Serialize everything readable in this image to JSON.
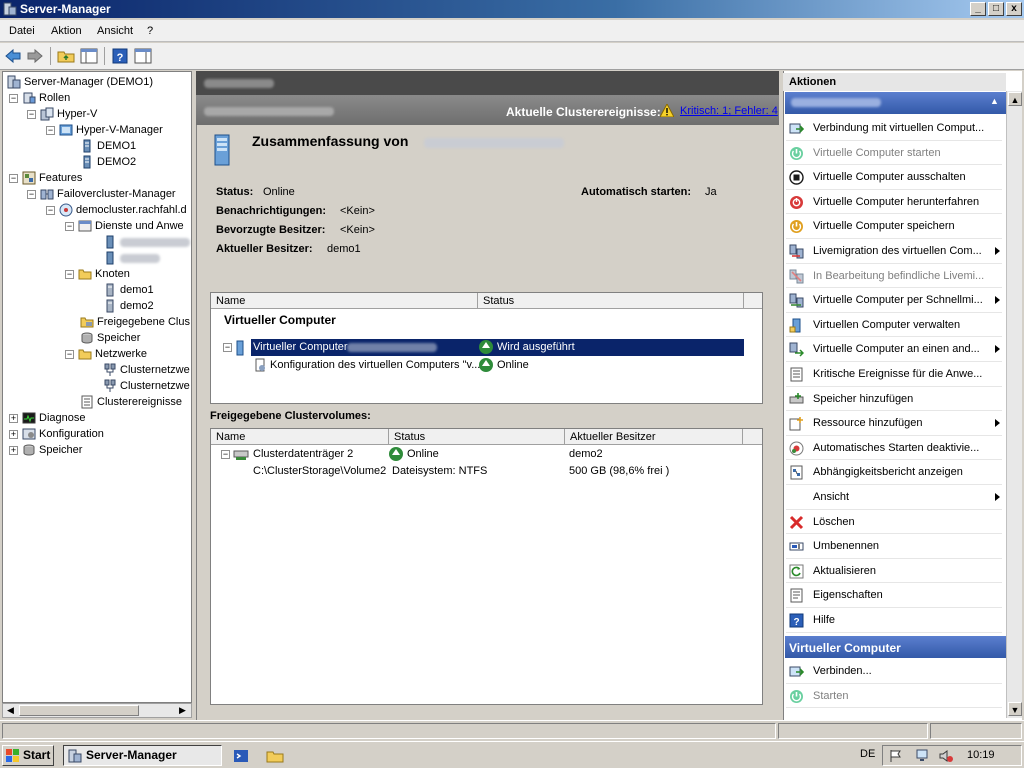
{
  "window": {
    "title": "Server-Manager",
    "controls": {
      "minimize": "_",
      "maximize": "□",
      "close": "x"
    }
  },
  "menu": [
    "Datei",
    "Aktion",
    "Ansicht",
    "?"
  ],
  "tree": {
    "items": [
      {
        "label": "Server-Manager (DEMO1)",
        "icon": "server-manager-icon"
      },
      {
        "label": "Rollen",
        "icon": "roles-icon"
      },
      {
        "label": "Hyper-V",
        "icon": "hyperv-icon"
      },
      {
        "label": "Hyper-V-Manager",
        "icon": "hyperv-manager-icon"
      },
      {
        "label": "DEMO1",
        "icon": "server-icon"
      },
      {
        "label": "DEMO2",
        "icon": "server-icon"
      },
      {
        "label": "Features",
        "icon": "features-icon"
      },
      {
        "label": "Failovercluster-Manager",
        "icon": "failover-cluster-icon"
      },
      {
        "label": "democluster.rachfahl.d",
        "icon": "cluster-icon"
      },
      {
        "label": "Dienste und Anwe",
        "icon": "services-icon"
      },
      {
        "label": "Knoten",
        "icon": "folder-icon"
      },
      {
        "label": "demo1",
        "icon": "server-icon"
      },
      {
        "label": "demo2",
        "icon": "server-icon"
      },
      {
        "label": "Freigegebene Clus",
        "icon": "shared-volume-icon"
      },
      {
        "label": "Speicher",
        "icon": "storage-icon"
      },
      {
        "label": "Netzwerke",
        "icon": "folder-icon"
      },
      {
        "label": "Clusternetzwe",
        "icon": "network-icon"
      },
      {
        "label": "Clusternetzwe",
        "icon": "network-icon"
      },
      {
        "label": "Clusterereignisse",
        "icon": "events-icon"
      },
      {
        "label": "Diagnose",
        "icon": "diagnose-icon"
      },
      {
        "label": "Konfiguration",
        "icon": "config-icon"
      },
      {
        "label": "Speicher",
        "icon": "storage-icon"
      }
    ]
  },
  "center": {
    "events_label": "Aktuelle Clusterereignisse:",
    "events_link": "Kritisch: 1; Fehler: 4",
    "summary_title": "Zusammenfassung von",
    "status_key": "Status:",
    "status_val": "Online",
    "autostart_key": "Automatisch starten:",
    "autostart_val": "Ja",
    "notif_key": "Benachrichtigungen:",
    "notif_val": "<Kein>",
    "preferred_key": "Bevorzugte Besitzer:",
    "preferred_val": "<Kein>",
    "owner_key": "Aktueller Besitzer:",
    "owner_val": "demo1",
    "vm_table": {
      "col_name": "Name",
      "col_status": "Status",
      "group": "Virtueller Computer",
      "rows": [
        {
          "name": "Virtueller Computer",
          "status": "Wird ausgeführt"
        },
        {
          "name": "Konfiguration des virtuellen Computers \"v...",
          "status": "Online"
        }
      ]
    },
    "volumes_title": "Freigegebene Clustervolumes:",
    "vol_table": {
      "col_name": "Name",
      "col_status": "Status",
      "col_owner": "Aktueller Besitzer",
      "rows": [
        {
          "name": "Clusterdatenträger 2",
          "status": "Online",
          "owner": "demo2"
        },
        {
          "name": "C:\\ClusterStorage\\Volume2",
          "status": "Dateisystem: NTFS",
          "owner": "500 GB (98,6% frei )"
        }
      ]
    }
  },
  "actions": {
    "header": "Aktionen",
    "group2_title": "Virtueller Computer",
    "items": [
      {
        "label": "Verbindung mit virtuellen Comput...",
        "icon": "connect-icon",
        "enabled": true,
        "submenu": false
      },
      {
        "label": "Virtuelle Computer starten",
        "icon": "start-icon",
        "enabled": false,
        "submenu": false
      },
      {
        "label": "Virtuelle Computer ausschalten",
        "icon": "power-off-icon",
        "enabled": true,
        "submenu": false
      },
      {
        "label": "Virtuelle Computer herunterfahren",
        "icon": "shutdown-icon",
        "enabled": true,
        "submenu": false
      },
      {
        "label": "Virtuelle Computer speichern",
        "icon": "save-state-icon",
        "enabled": true,
        "submenu": false
      },
      {
        "label": "Livemigration des virtuellen Com...",
        "icon": "live-migration-icon",
        "enabled": true,
        "submenu": true
      },
      {
        "label": "In Bearbeitung befindliche Livemi...",
        "icon": "migration-progress-icon",
        "enabled": false,
        "submenu": false
      },
      {
        "label": "Virtuelle Computer per Schnellmi...",
        "icon": "quick-migration-icon",
        "enabled": true,
        "submenu": true
      },
      {
        "label": "Virtuellen Computer verwalten",
        "icon": "manage-vm-icon",
        "enabled": true,
        "submenu": false
      },
      {
        "label": "Virtuelle Computer an einen and...",
        "icon": "move-vm-icon",
        "enabled": true,
        "submenu": true
      },
      {
        "label": "Kritische Ereignisse für die Anwe...",
        "icon": "critical-events-icon",
        "enabled": true,
        "submenu": false
      },
      {
        "label": "Speicher hinzufügen",
        "icon": "add-storage-icon",
        "enabled": true,
        "submenu": false
      },
      {
        "label": "Ressource hinzufügen",
        "icon": "add-resource-icon",
        "enabled": true,
        "submenu": true
      },
      {
        "label": "Automatisches Starten deaktivie...",
        "icon": "autostart-icon",
        "enabled": true,
        "submenu": false
      },
      {
        "label": "Abhängigkeitsbericht anzeigen",
        "icon": "report-icon",
        "enabled": true,
        "submenu": false
      },
      {
        "label": "Ansicht",
        "icon": "",
        "enabled": true,
        "submenu": true
      },
      {
        "label": "Löschen",
        "icon": "delete-icon",
        "enabled": true,
        "submenu": false
      },
      {
        "label": "Umbenennen",
        "icon": "rename-icon",
        "enabled": true,
        "submenu": false
      },
      {
        "label": "Aktualisieren",
        "icon": "refresh-icon",
        "enabled": true,
        "submenu": false
      },
      {
        "label": "Eigenschaften",
        "icon": "properties-icon",
        "enabled": true,
        "submenu": false
      },
      {
        "label": "Hilfe",
        "icon": "help-icon",
        "enabled": true,
        "submenu": false
      }
    ],
    "group2_items": [
      {
        "label": "Verbinden...",
        "icon": "connect-icon",
        "enabled": true
      },
      {
        "label": "Starten",
        "icon": "start-icon",
        "enabled": false
      }
    ]
  },
  "taskbar": {
    "start_label": "Start",
    "app_label": "Server-Manager",
    "language": "DE",
    "clock": "10:19"
  }
}
